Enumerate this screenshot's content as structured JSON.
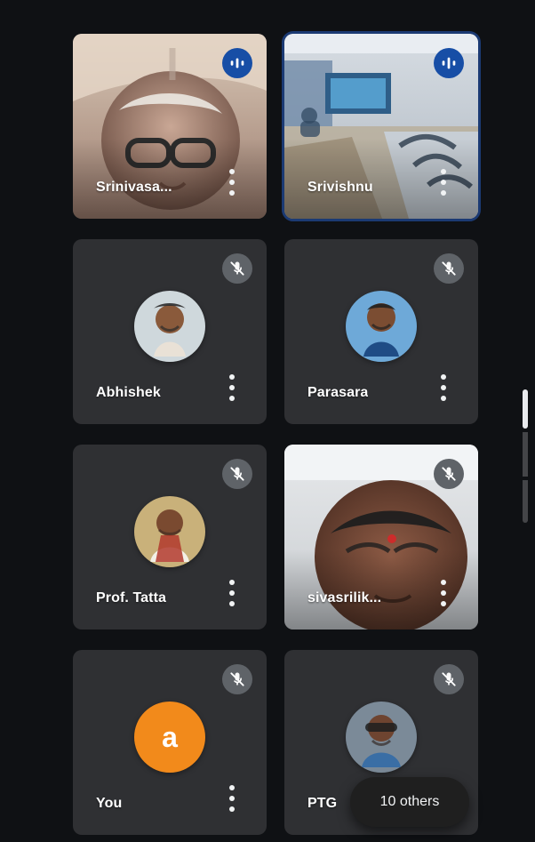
{
  "participants": [
    {
      "name": "Srinivasa...",
      "state": "speaking",
      "has_video": true,
      "avatar_style": "photo"
    },
    {
      "name": "Srivishnu",
      "state": "speaking",
      "has_video": true,
      "avatar_style": "photo"
    },
    {
      "name": "Abhishek",
      "state": "muted",
      "has_video": false,
      "avatar_style": "photo"
    },
    {
      "name": "Parasara",
      "state": "muted",
      "has_video": false,
      "avatar_style": "photo"
    },
    {
      "name": "Prof. Tatta",
      "state": "muted",
      "has_video": false,
      "avatar_style": "photo"
    },
    {
      "name": "sivasrilik...",
      "state": "muted",
      "has_video": true,
      "avatar_style": "photo"
    },
    {
      "name": "You",
      "state": "muted",
      "has_video": false,
      "avatar_style": "letter",
      "avatar_letter": "a"
    },
    {
      "name": "PTG",
      "state": "muted",
      "has_video": false,
      "avatar_style": "photo"
    }
  ],
  "overflow_pill": {
    "label": "10 others"
  },
  "icons": {
    "speaking": "audio-level-icon",
    "muted": "mic-off-icon",
    "more": "more-vert-icon"
  },
  "colors": {
    "background": "#0f1114",
    "tile": "#2f3033",
    "speaking_badge": "#174ea6",
    "muted_badge": "#5f6368",
    "you_avatar": "#f28a1b"
  }
}
